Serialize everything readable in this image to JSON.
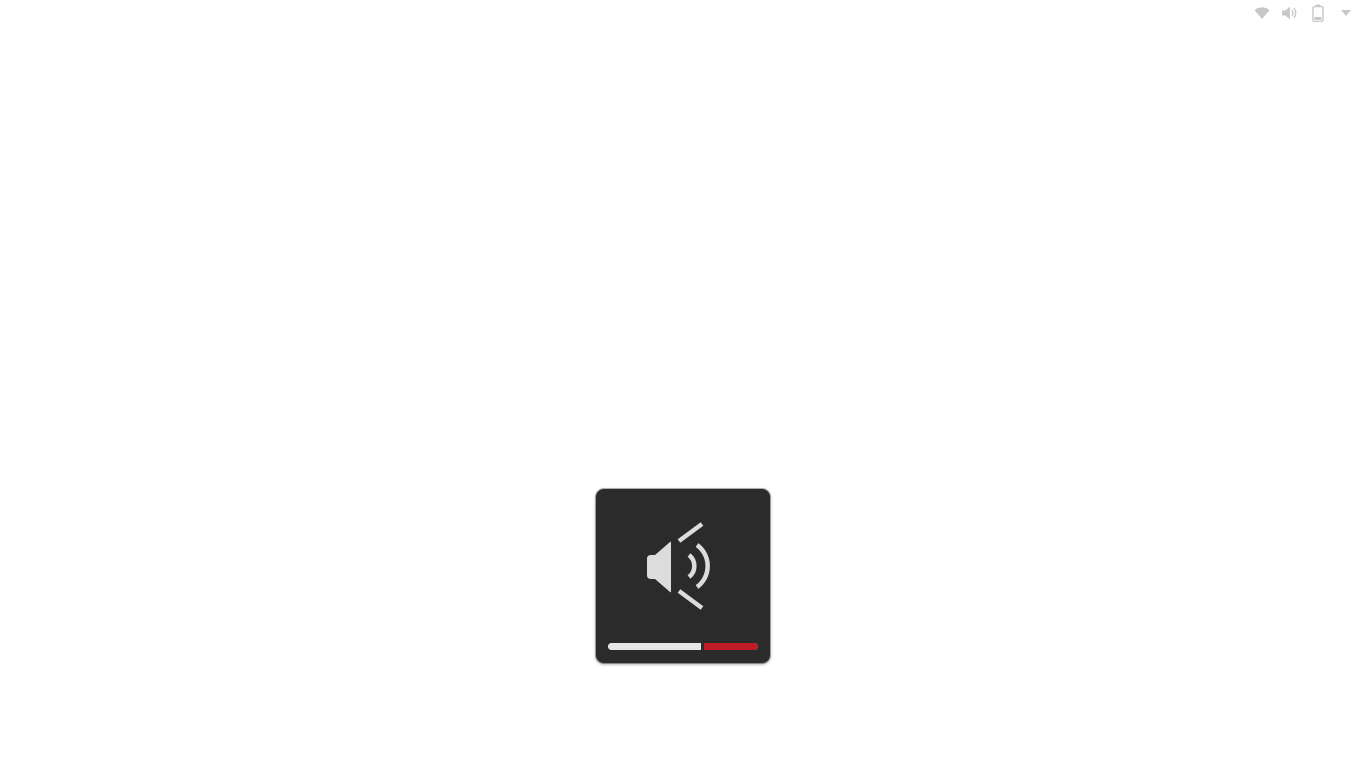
{
  "tray": {
    "icons": [
      "wifi-icon",
      "volume-icon",
      "battery-icon",
      "menu-arrow-icon"
    ],
    "icon_color": "#c8c8c8"
  },
  "osd": {
    "icon": "volume-high-icon",
    "background_color": "#2b2b2b",
    "icon_color": "#dcdcdc",
    "volume_level": 1.0,
    "normal_segment_fraction": 0.64,
    "overamplified_segment_fraction": 0.36,
    "normal_bar_color": "#e6e6e6",
    "over_amplified_color": "#c01c28"
  }
}
